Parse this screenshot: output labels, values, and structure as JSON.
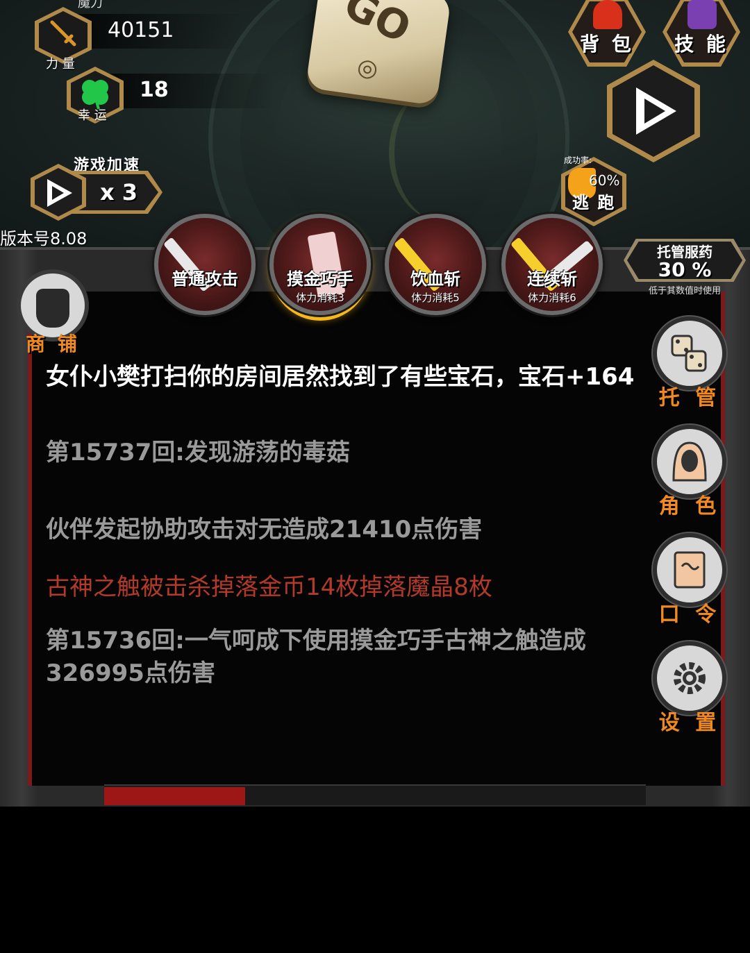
{
  "stats": {
    "mana_label": "魔力",
    "strength": {
      "label": "力 量",
      "value": "40151",
      "icon": "sword-icon"
    },
    "luck": {
      "label": "幸 运",
      "value": "18",
      "icon": "clover-icon"
    }
  },
  "dice": {
    "face": "GO",
    "icon": "dice-icon"
  },
  "top_buttons": {
    "backpack": "背 包",
    "skills": "技 能"
  },
  "game_speed": {
    "title": "游戏加速",
    "multiplier": "x 3"
  },
  "escape": {
    "rate_label": "成功率:",
    "rate": "60%",
    "label": "逃 跑"
  },
  "version": "版本号8.08",
  "skills": [
    {
      "name": "普通攻击",
      "cost": ""
    },
    {
      "name": "摸金巧手",
      "cost": "体力消耗3"
    },
    {
      "name": "饮血斩",
      "cost": "体力消耗5"
    },
    {
      "name": "连续斩",
      "cost": "体力消耗6"
    }
  ],
  "auto_medicine": {
    "title": "托管服药",
    "value": "30 %",
    "note": "低于其数值时使用"
  },
  "shop": {
    "label": "商 铺"
  },
  "side_buttons": {
    "auto": "托 管",
    "character": "角 色",
    "command": "口 令",
    "settings": "设 置"
  },
  "log": [
    {
      "text": "女仆小樊打扫你的房间居然找到了有些宝石，宝石+164",
      "style": "white"
    },
    {
      "text": "第15737回:发现游荡的毒菇",
      "style": "grey"
    },
    {
      "text": "伙伴发起协助攻击对无造成21410点伤害",
      "style": "grey"
    },
    {
      "text": "古神之触被击杀掉落金币14枚掉落魔晶8枚",
      "style": "red"
    },
    {
      "text": "第15736回:一气呵成下使用摸金巧手古神之触造成326995点伤害",
      "style": "grey"
    }
  ],
  "colors": {
    "accent_orange": "#f08a20",
    "gold_frame": "#b08a4a",
    "log_red": "#b33a2a",
    "log_grey": "#9a9a9a",
    "hp_red": "#9e1717"
  },
  "hp_fraction": 0.26
}
